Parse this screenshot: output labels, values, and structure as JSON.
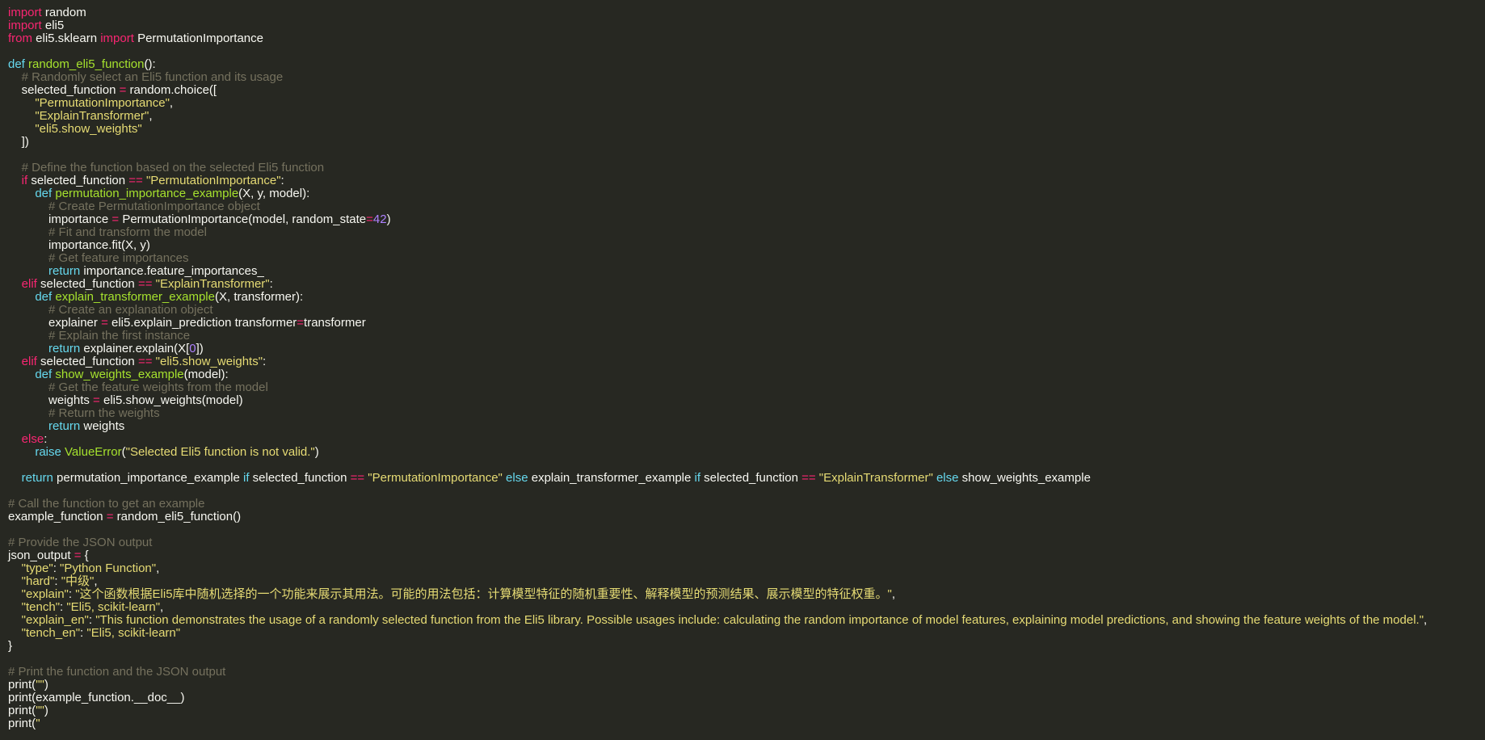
{
  "colors": {
    "background": "#272822",
    "text": "#f8f8f2",
    "keyword": "#f92672",
    "definition_keyword": "#66d9ef",
    "function_name": "#a6e22e",
    "string": "#e6db74",
    "number": "#ae81ff",
    "comment": "#75715e"
  },
  "code_lines": [
    [
      [
        "kw",
        "import"
      ],
      [
        "pl",
        " random"
      ]
    ],
    [
      [
        "kw",
        "import"
      ],
      [
        "pl",
        " eli5"
      ]
    ],
    [
      [
        "kw",
        "from"
      ],
      [
        "pl",
        " eli5.sklearn "
      ],
      [
        "kw",
        "import"
      ],
      [
        "pl",
        " PermutationImportance"
      ]
    ],
    [],
    [
      [
        "def",
        "def"
      ],
      [
        "pl",
        " "
      ],
      [
        "fn",
        "random_eli5_function"
      ],
      [
        "pl",
        "():"
      ]
    ],
    [
      [
        "pl",
        "    "
      ],
      [
        "cm",
        "# Randomly select an Eli5 function and its usage"
      ]
    ],
    [
      [
        "pl",
        "    selected_function "
      ],
      [
        "op",
        "="
      ],
      [
        "pl",
        " random.choice(["
      ]
    ],
    [
      [
        "pl",
        "        "
      ],
      [
        "str",
        "\"PermutationImportance\""
      ],
      [
        "pl",
        ","
      ]
    ],
    [
      [
        "pl",
        "        "
      ],
      [
        "str",
        "\"ExplainTransformer\""
      ],
      [
        "pl",
        ","
      ]
    ],
    [
      [
        "pl",
        "        "
      ],
      [
        "str",
        "\"eli5.show_weights\""
      ]
    ],
    [
      [
        "pl",
        "    ])"
      ]
    ],
    [],
    [
      [
        "pl",
        "    "
      ],
      [
        "cm",
        "# Define the function based on the selected Eli5 function"
      ]
    ],
    [
      [
        "pl",
        "    "
      ],
      [
        "kw",
        "if"
      ],
      [
        "pl",
        " selected_function "
      ],
      [
        "op",
        "=="
      ],
      [
        "pl",
        " "
      ],
      [
        "str",
        "\"PermutationImportance\""
      ],
      [
        "pl",
        ":"
      ]
    ],
    [
      [
        "pl",
        "        "
      ],
      [
        "def",
        "def"
      ],
      [
        "pl",
        " "
      ],
      [
        "fn",
        "permutation_importance_example"
      ],
      [
        "pl",
        "(X, y, model):"
      ]
    ],
    [
      [
        "pl",
        "            "
      ],
      [
        "cm",
        "# Create PermutationImportance object"
      ]
    ],
    [
      [
        "pl",
        "            importance "
      ],
      [
        "op",
        "="
      ],
      [
        "pl",
        " PermutationImportance(model, random_state"
      ],
      [
        "op",
        "="
      ],
      [
        "num",
        "42"
      ],
      [
        "pl",
        ")"
      ]
    ],
    [
      [
        "pl",
        "            "
      ],
      [
        "cm",
        "# Fit and transform the model"
      ]
    ],
    [
      [
        "pl",
        "            importance.fit(X, y)"
      ]
    ],
    [
      [
        "pl",
        "            "
      ],
      [
        "cm",
        "# Get feature importances"
      ]
    ],
    [
      [
        "pl",
        "            "
      ],
      [
        "def",
        "return"
      ],
      [
        "pl",
        " importance.feature_importances_"
      ]
    ],
    [
      [
        "pl",
        "    "
      ],
      [
        "kw",
        "elif"
      ],
      [
        "pl",
        " selected_function "
      ],
      [
        "op",
        "=="
      ],
      [
        "pl",
        " "
      ],
      [
        "str",
        "\"ExplainTransformer\""
      ],
      [
        "pl",
        ":"
      ]
    ],
    [
      [
        "pl",
        "        "
      ],
      [
        "def",
        "def"
      ],
      [
        "pl",
        " "
      ],
      [
        "fn",
        "explain_transformer_example"
      ],
      [
        "pl",
        "(X, transformer):"
      ]
    ],
    [
      [
        "pl",
        "            "
      ],
      [
        "cm",
        "# Create an explanation object"
      ]
    ],
    [
      [
        "pl",
        "            explainer "
      ],
      [
        "op",
        "="
      ],
      [
        "pl",
        " eli5.explain_prediction transformer"
      ],
      [
        "op",
        "="
      ],
      [
        "pl",
        "transformer"
      ]
    ],
    [
      [
        "pl",
        "            "
      ],
      [
        "cm",
        "# Explain the first instance"
      ]
    ],
    [
      [
        "pl",
        "            "
      ],
      [
        "def",
        "return"
      ],
      [
        "pl",
        " explainer.explain(X["
      ],
      [
        "num",
        "0"
      ],
      [
        "pl",
        "])"
      ]
    ],
    [
      [
        "pl",
        "    "
      ],
      [
        "kw",
        "elif"
      ],
      [
        "pl",
        " selected_function "
      ],
      [
        "op",
        "=="
      ],
      [
        "pl",
        " "
      ],
      [
        "str",
        "\"eli5.show_weights\""
      ],
      [
        "pl",
        ":"
      ]
    ],
    [
      [
        "pl",
        "        "
      ],
      [
        "def",
        "def"
      ],
      [
        "pl",
        " "
      ],
      [
        "fn",
        "show_weights_example"
      ],
      [
        "pl",
        "(model):"
      ]
    ],
    [
      [
        "pl",
        "            "
      ],
      [
        "cm",
        "# Get the feature weights from the model"
      ]
    ],
    [
      [
        "pl",
        "            weights "
      ],
      [
        "op",
        "="
      ],
      [
        "pl",
        " eli5.show_weights(model)"
      ]
    ],
    [
      [
        "pl",
        "            "
      ],
      [
        "cm",
        "# Return the weights"
      ]
    ],
    [
      [
        "pl",
        "            "
      ],
      [
        "def",
        "return"
      ],
      [
        "pl",
        " weights"
      ]
    ],
    [
      [
        "pl",
        "    "
      ],
      [
        "kw",
        "else"
      ],
      [
        "pl",
        ":"
      ]
    ],
    [
      [
        "pl",
        "        "
      ],
      [
        "def",
        "raise"
      ],
      [
        "pl",
        " "
      ],
      [
        "cls",
        "ValueError"
      ],
      [
        "pl",
        "("
      ],
      [
        "str",
        "\"Selected Eli5 function is not valid.\""
      ],
      [
        "pl",
        ")"
      ]
    ],
    [],
    [
      [
        "pl",
        "    "
      ],
      [
        "def",
        "return"
      ],
      [
        "pl",
        " permutation_importance_example "
      ],
      [
        "def",
        "if"
      ],
      [
        "pl",
        " selected_function "
      ],
      [
        "op",
        "=="
      ],
      [
        "pl",
        " "
      ],
      [
        "str",
        "\"PermutationImportance\""
      ],
      [
        "pl",
        " "
      ],
      [
        "def",
        "else"
      ],
      [
        "pl",
        " explain_transformer_example "
      ],
      [
        "def",
        "if"
      ],
      [
        "pl",
        " selected_function "
      ],
      [
        "op",
        "=="
      ],
      [
        "pl",
        " "
      ],
      [
        "str",
        "\"ExplainTransformer\""
      ],
      [
        "pl",
        " "
      ],
      [
        "def",
        "else"
      ],
      [
        "pl",
        " show_weights_example"
      ]
    ],
    [],
    [
      [
        "cm",
        "# Call the function to get an example"
      ]
    ],
    [
      [
        "pl",
        "example_function "
      ],
      [
        "op",
        "="
      ],
      [
        "pl",
        " random_eli5_function()"
      ]
    ],
    [],
    [
      [
        "cm",
        "# Provide the JSON output"
      ]
    ],
    [
      [
        "pl",
        "json_output "
      ],
      [
        "op",
        "="
      ],
      [
        "pl",
        " {"
      ]
    ],
    [
      [
        "pl",
        "    "
      ],
      [
        "str",
        "\"type\""
      ],
      [
        "pl",
        ": "
      ],
      [
        "str",
        "\"Python Function\""
      ],
      [
        "pl",
        ","
      ]
    ],
    [
      [
        "pl",
        "    "
      ],
      [
        "str",
        "\"hard\""
      ],
      [
        "pl",
        ": "
      ],
      [
        "str",
        "\"中级\""
      ],
      [
        "pl",
        ","
      ]
    ],
    [
      [
        "pl",
        "    "
      ],
      [
        "str",
        "\"explain\""
      ],
      [
        "pl",
        ": "
      ],
      [
        "str",
        "\"这个函数根据Eli5库中随机选择的一个功能来展示其用法。可能的用法包括：计算模型特征的随机重要性、解释模型的预测结果、展示模型的特征权重。\""
      ],
      [
        "pl",
        ","
      ]
    ],
    [
      [
        "pl",
        "    "
      ],
      [
        "str",
        "\"tench\""
      ],
      [
        "pl",
        ": "
      ],
      [
        "str",
        "\"Eli5, scikit-learn\""
      ],
      [
        "pl",
        ","
      ]
    ],
    [
      [
        "pl",
        "    "
      ],
      [
        "str",
        "\"explain_en\""
      ],
      [
        "pl",
        ": "
      ],
      [
        "str",
        "\"This function demonstrates the usage of a randomly selected function from the Eli5 library. Possible usages include: calculating the random importance of model features, explaining model predictions, and showing the feature weights of the model.\""
      ],
      [
        "pl",
        ","
      ]
    ],
    [
      [
        "pl",
        "    "
      ],
      [
        "str",
        "\"tench_en\""
      ],
      [
        "pl",
        ": "
      ],
      [
        "str",
        "\"Eli5, scikit-learn\""
      ]
    ],
    [
      [
        "pl",
        "}"
      ]
    ],
    [],
    [
      [
        "cm",
        "# Print the function and the JSON output"
      ]
    ],
    [
      [
        "pl",
        "print("
      ],
      [
        "str",
        "\"\""
      ],
      [
        "pl",
        ")"
      ]
    ],
    [
      [
        "pl",
        "print(example_function.__doc__)"
      ]
    ],
    [
      [
        "pl",
        "print("
      ],
      [
        "str",
        "\"\""
      ],
      [
        "pl",
        ")"
      ]
    ],
    [
      [
        "pl",
        "print("
      ],
      [
        "str",
        "\""
      ]
    ]
  ]
}
